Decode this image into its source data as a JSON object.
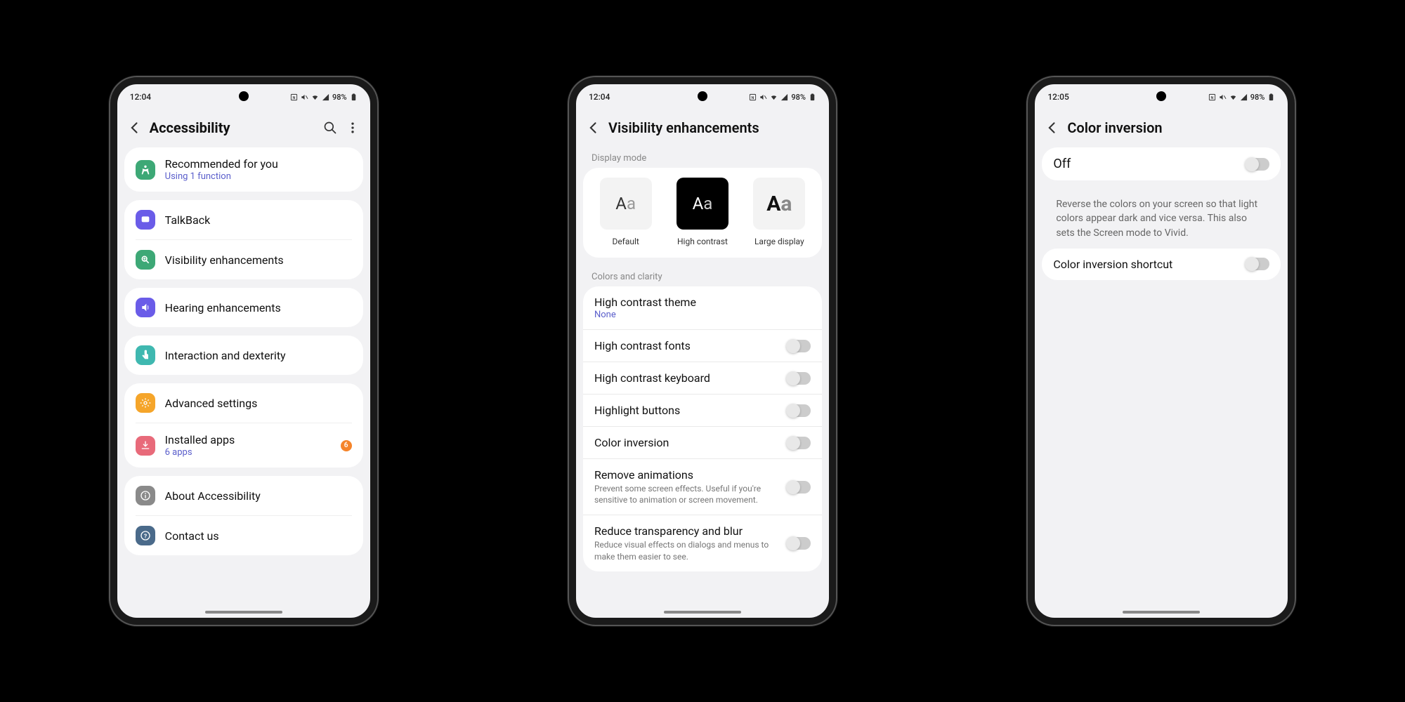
{
  "phone1": {
    "time": "12:04",
    "battery": "98%",
    "title": "Accessibility",
    "recommended": {
      "title": "Recommended for you",
      "sub": "Using 1 function"
    },
    "items": {
      "talkback": "TalkBack",
      "visibility": "Visibility enhancements",
      "hearing": "Hearing enhancements",
      "interaction": "Interaction and dexterity",
      "advanced": "Advanced settings",
      "installed": "Installed apps",
      "installed_sub": "6 apps",
      "installed_badge": "6",
      "about": "About Accessibility",
      "contact": "Contact us"
    }
  },
  "phone2": {
    "time": "12:04",
    "battery": "98%",
    "title": "Visibility enhancements",
    "section_display": "Display mode",
    "modes": {
      "default": "Default",
      "contrast": "High contrast",
      "large": "Large display"
    },
    "section_colors": "Colors and clarity",
    "rows": {
      "theme": "High contrast theme",
      "theme_sub": "None",
      "fonts": "High contrast fonts",
      "keyboard": "High contrast keyboard",
      "highlight": "Highlight buttons",
      "inversion": "Color inversion",
      "animations": "Remove animations",
      "animations_desc": "Prevent some screen effects. Useful if you're sensitive to animation or screen movement.",
      "transparency": "Reduce transparency and blur",
      "transparency_desc": "Reduce visual effects on dialogs and menus to make them easier to see."
    }
  },
  "phone3": {
    "time": "12:05",
    "battery": "98%",
    "title": "Color inversion",
    "off": "Off",
    "desc": "Reverse the colors on your screen so that light colors appear dark and vice versa. This also sets the Screen mode to Vivid.",
    "shortcut": "Color inversion shortcut"
  }
}
